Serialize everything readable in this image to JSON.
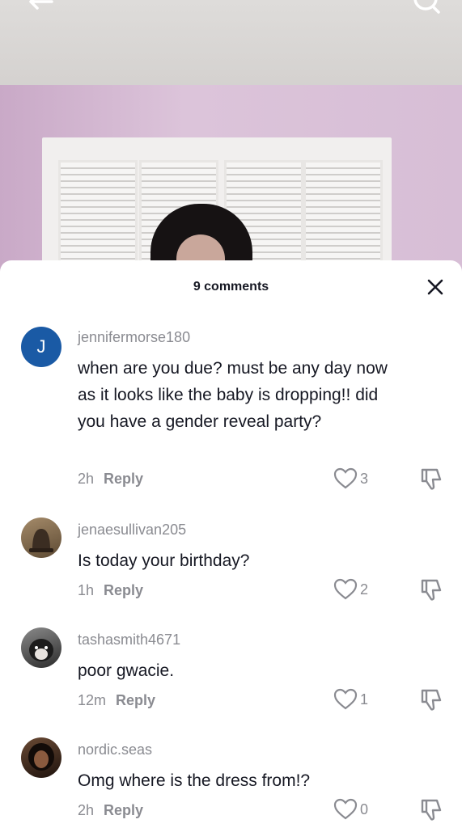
{
  "header": {
    "back_icon": "back-arrow-icon",
    "search_icon": "search-icon"
  },
  "sheet": {
    "title": "9 comments",
    "close_icon": "close-icon"
  },
  "comments": [
    {
      "avatar_letter": "J",
      "avatar_color": "#1a5aa5",
      "username": "jennifermorse180",
      "text": "when are you due? must be any day now as it looks like the baby is dropping!! did you have a gender reveal party?",
      "time": "2h",
      "reply": "Reply",
      "likes": "3"
    },
    {
      "avatar_letter": "",
      "avatar_color": "#6b5a44",
      "username": "jenaesullivan205",
      "text": "Is today your birthday?",
      "time": "1h",
      "reply": "Reply",
      "likes": "2"
    },
    {
      "avatar_letter": "",
      "avatar_color": "#3a3a3a",
      "username": "tashasmith4671",
      "text": "poor gwacie.",
      "time": "12m",
      "reply": "Reply",
      "likes": "1"
    },
    {
      "avatar_letter": "",
      "avatar_color": "#2a1a14",
      "username": "nordic.seas",
      "text": "Omg where is the dress from!?",
      "time": "2h",
      "reply": "Reply",
      "likes": "0"
    }
  ]
}
